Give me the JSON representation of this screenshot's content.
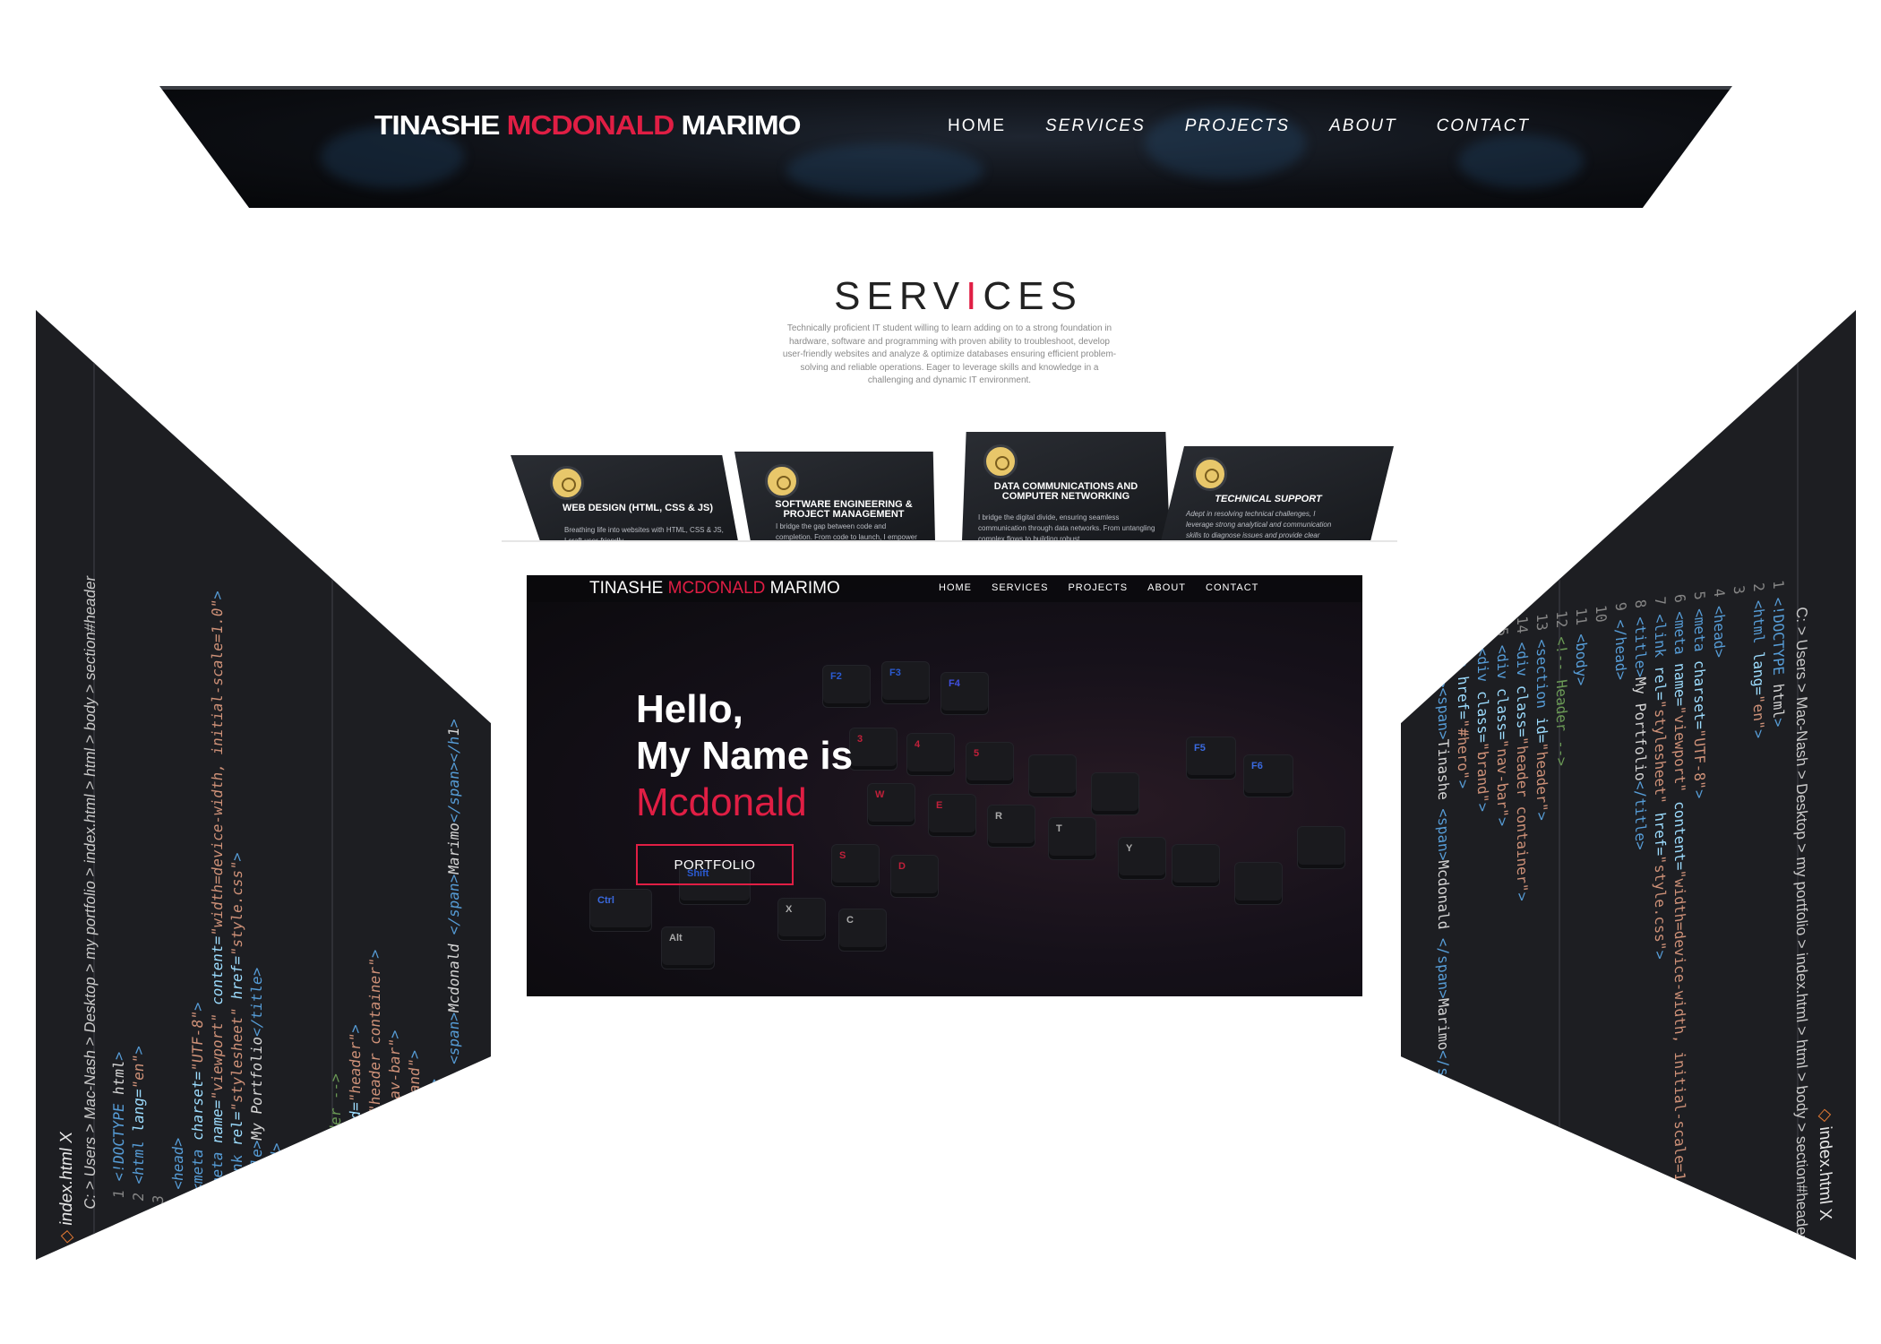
{
  "site": {
    "brand_first": "TINASHE ",
    "brand_middle": "MCDONALD",
    "brand_last": " MARIMO",
    "nav": [
      "HOME",
      "SERVICES",
      "PROJECTS",
      "ABOUT",
      "CONTACT"
    ],
    "accent_color": "#e01e44"
  },
  "services": {
    "title_part1": "SERV",
    "title_accent": "I",
    "title_part2": "CES",
    "description": "Technically proficient IT student willing to learn adding on to a strong foundation in hardware, software and programming with proven ability to troubleshoot, develop user-friendly websites and analyze & optimize databases ensuring efficient problem-solving and reliable operations. Eager to leverage skills and knowledge in a challenging and dynamic IT environment.",
    "cards": [
      {
        "title": "WEB DESIGN (HTML, CSS & JS)",
        "text": "Breathing life into websites with HTML, CSS & JS, I craft user-friendly",
        "icon": "gear-icon"
      },
      {
        "title": "SOFTWARE ENGINEERING & PROJECT MANAGEMENT",
        "text": "I bridge the gap between code and completion. From code to launch, I empower solutions and support",
        "icon": "gear-icon"
      },
      {
        "title": "DATA COMMUNICATIONS AND COMPUTER NETWORKING",
        "text": "I bridge the digital divide, ensuring seamless communication through data networks. From untangling complex flows to building robust",
        "icon": "gear-icon"
      },
      {
        "title": "TECHNICAL SUPPORT",
        "text": "Adept in resolving technical challenges, I leverage strong analytical and communication skills to diagnose issues and provide clear",
        "icon": "gear-icon"
      }
    ]
  },
  "hero": {
    "greeting_line1": "Hello,",
    "greeting_line2": "My Name is",
    "greeting_name": "Mcdonald",
    "button": "PORTFOLIO",
    "keys": [
      "F2",
      "F3",
      "F4",
      "F5",
      "F6",
      "3",
      "4",
      "5",
      "W",
      "E",
      "R",
      "T",
      "S",
      "D",
      "X",
      "C",
      "Alt",
      "Ctrl",
      "Shift",
      "Y"
    ]
  },
  "editor": {
    "tab": "index.html",
    "close": "X",
    "breadcrumb": "C: > Users > Mac-Nash > Desktop > my portfolio > index.html > html > body > section#header",
    "lines": [
      {
        "n": "1",
        "code": "<!DOCTYPE html>"
      },
      {
        "n": "2",
        "code": "<html lang=\"en\">"
      },
      {
        "n": "3",
        "code": ""
      },
      {
        "n": "4",
        "code": "<head>"
      },
      {
        "n": "5",
        "code": "  <meta charset=\"UTF-8\">"
      },
      {
        "n": "6",
        "code": "  <meta name=\"viewport\" content=\"width=device-width, initial-scale=1.0\">"
      },
      {
        "n": "7",
        "code": "  <link rel=\"stylesheet\" href=\"style.css\">"
      },
      {
        "n": "8",
        "code": "  <title>My Portfolio</title>"
      },
      {
        "n": "9",
        "code": "</head>"
      },
      {
        "n": "10",
        "code": ""
      },
      {
        "n": "11",
        "code": "<body>"
      },
      {
        "n": "12",
        "code": "  <!-- Header -->"
      },
      {
        "n": "13",
        "code": "  <section id=\"header\">"
      },
      {
        "n": "14",
        "code": "    <div class=\"header container\">"
      },
      {
        "n": "15",
        "code": "      <div class=\"nav-bar\">"
      },
      {
        "n": "16",
        "code": "        <div class=\"brand\">"
      },
      {
        "n": "17",
        "code": "          <a href=\"#hero\">"
      },
      {
        "n": "18",
        "code": "            <h1><span>Tinashe <span>Mcdonald </span>Marimo</span></h1>"
      }
    ]
  }
}
